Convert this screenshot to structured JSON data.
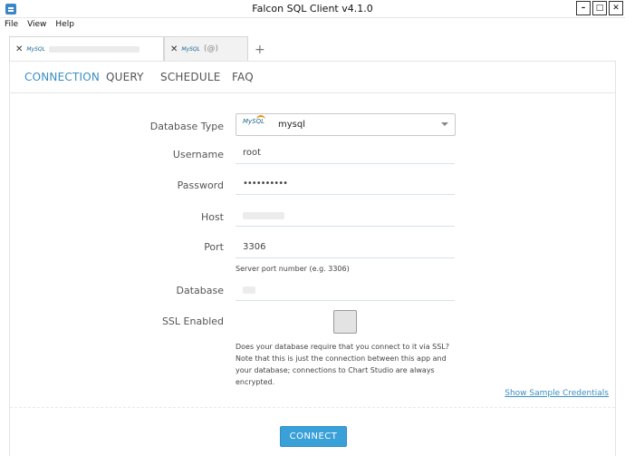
{
  "window": {
    "title": "Falcon SQL Client v4.1.0",
    "controls": [
      "–",
      "□",
      "✕"
    ]
  },
  "menu": [
    "File",
    "View",
    "Help"
  ],
  "tabs": [
    {
      "close": "✕",
      "logo": "MySQL",
      "label": ""
    },
    {
      "close": "✕",
      "logo": "MySQL",
      "label": "(@)"
    }
  ],
  "add_tab": "+",
  "nav": {
    "items": [
      "CONNECTION",
      "QUERY",
      "SCHEDULE",
      "FAQ"
    ],
    "active": "CONNECTION"
  },
  "form": {
    "database_type": {
      "label": "Database Type",
      "value": "mysql",
      "logo": "MySQL"
    },
    "username": {
      "label": "Username",
      "value": "root"
    },
    "password": {
      "label": "Password",
      "value": "••••••••••"
    },
    "host": {
      "label": "Host",
      "value": ""
    },
    "port": {
      "label": "Port",
      "value": "3306",
      "hint": "Server port number (e.g. 3306)"
    },
    "database": {
      "label": "Database",
      "value": ""
    },
    "ssl": {
      "label": "SSL Enabled",
      "checked": false,
      "hint_lines": [
        "Does your database require that you connect to it via SSL?",
        "Note that this is just the connection between this app and",
        "your database; connections to Chart Studio are always",
        "encrypted."
      ]
    }
  },
  "show_credentials_link": "Show Sample Credentials",
  "connect_button": "CONNECT",
  "colors": {
    "accent": "#3a8ec3",
    "button": "#3aa0d8"
  }
}
